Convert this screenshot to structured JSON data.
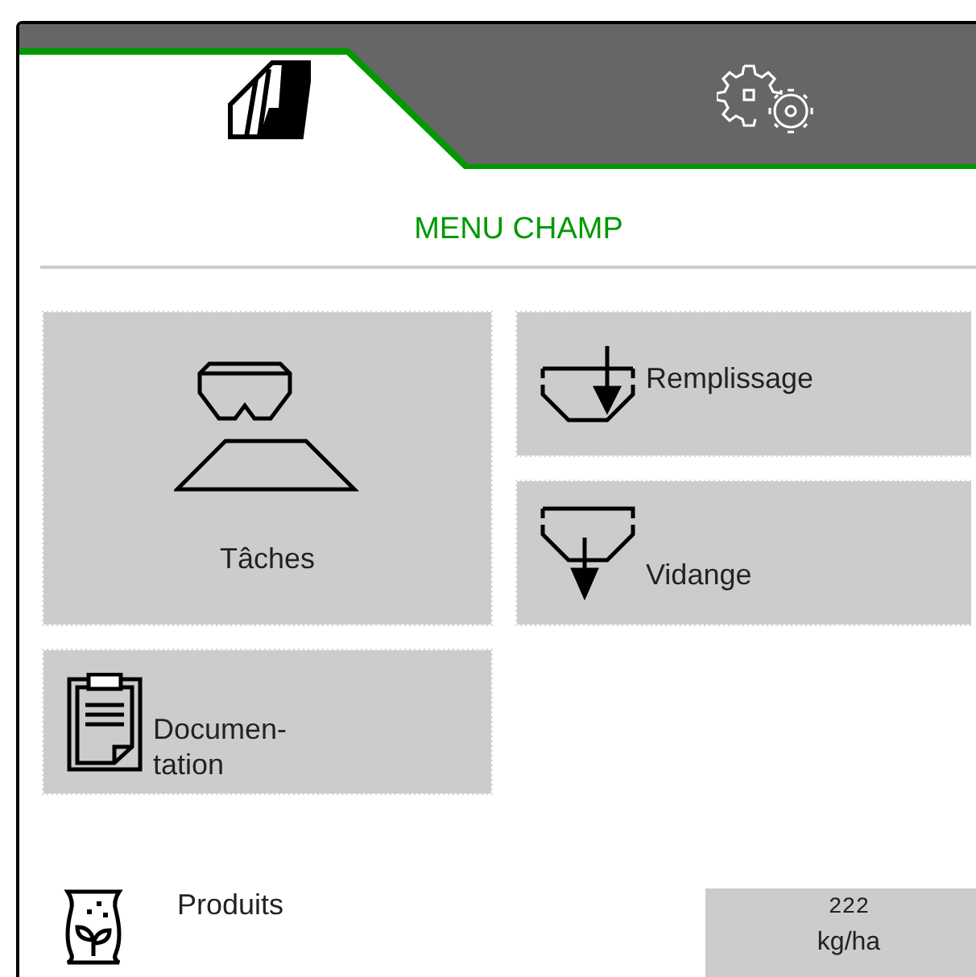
{
  "tabs": [
    {
      "selected": true
    },
    {
      "selected": false
    }
  ],
  "title": "MENU CHAMP",
  "tiles": [
    {
      "kind": "large",
      "label": "Tâches"
    },
    {
      "kind": "small",
      "label": "Remplissage"
    },
    {
      "kind": "small",
      "label": "Vidange"
    },
    {
      "kind": "small",
      "label": "Documen-\ntation"
    }
  ],
  "product": {
    "label": "Produits",
    "value": "222",
    "unit": "kg/ha"
  }
}
